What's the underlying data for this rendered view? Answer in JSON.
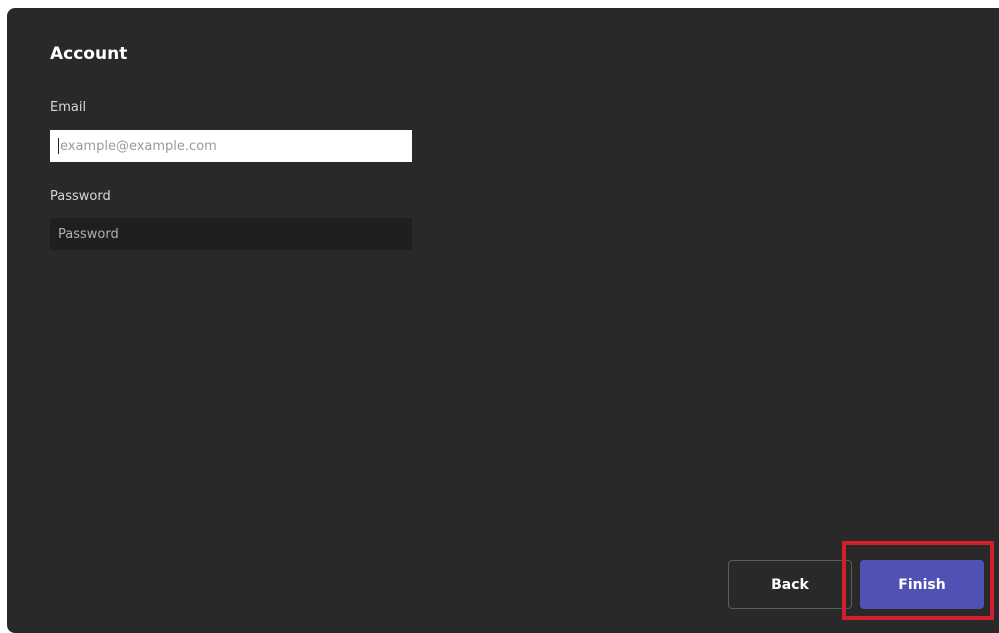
{
  "form": {
    "title": "Account",
    "email": {
      "label": "Email",
      "value": "",
      "placeholder": "example@example.com"
    },
    "password": {
      "label": "Password",
      "value": "",
      "placeholder": "Password"
    }
  },
  "actions": {
    "back_label": "Back",
    "finish_label": "Finish"
  },
  "colors": {
    "panel_background": "#292929",
    "primary_button": "#4f52b2",
    "highlight_outline": "#d0202e"
  }
}
